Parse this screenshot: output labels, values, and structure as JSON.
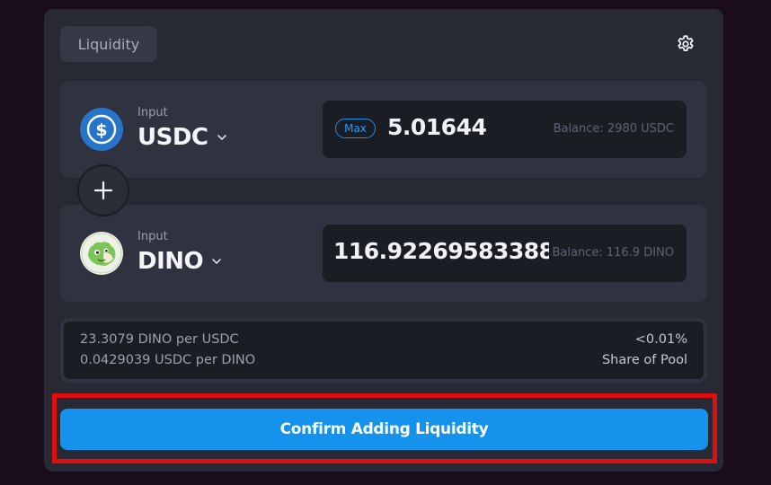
{
  "header": {
    "tab_label": "Liquidity",
    "settings_icon": "gear-icon"
  },
  "inputs": [
    {
      "label": "Input",
      "token": "USDC",
      "icon": "usdc-icon",
      "max_label": "Max",
      "amount": "5.01644",
      "balance": "Balance: 2980 USDC"
    },
    {
      "label": "Input",
      "token": "DINO",
      "icon": "dino-icon",
      "amount": "116.92269583388...",
      "balance": "Balance: 116.9 DINO"
    }
  ],
  "plus_icon": "plus-icon",
  "pool_info": {
    "rate_1": "23.3079 DINO per USDC",
    "rate_2": "0.0429039 USDC per DINO",
    "share_value": "<0.01%",
    "share_label": "Share of Pool"
  },
  "confirm_label": "Confirm Adding Liquidity",
  "colors": {
    "background": "#1a0c1b",
    "panel": "#272a35",
    "card": "#2f323f",
    "input_box": "#1b1d25",
    "accent": "#1593ec",
    "usdc_blue": "#2775ca",
    "highlight_red": "#e00f0f"
  }
}
